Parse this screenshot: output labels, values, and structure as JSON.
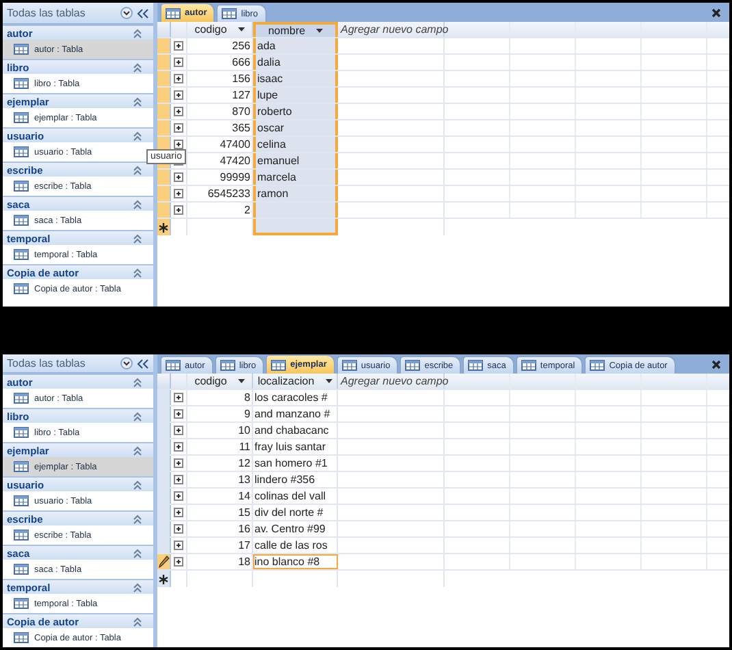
{
  "panels": [
    {
      "nav": {
        "title": "Todas las tablas",
        "groups": [
          {
            "name": "autor",
            "item": "autor : Tabla",
            "selected": true
          },
          {
            "name": "libro",
            "item": "libro : Tabla",
            "selected": false
          },
          {
            "name": "ejemplar",
            "item": "ejemplar : Tabla",
            "selected": false
          },
          {
            "name": "usuario",
            "item": "usuario : Tabla",
            "selected": false
          },
          {
            "name": "escribe",
            "item": "escribe : Tabla",
            "selected": false
          },
          {
            "name": "saca",
            "item": "saca : Tabla",
            "selected": false
          },
          {
            "name": "temporal",
            "item": "temporal : Tabla",
            "selected": false
          },
          {
            "name": "Copia de autor",
            "item": "Copia de autor : Tabla",
            "selected": false
          }
        ]
      },
      "tooltip": "usuario",
      "tabs": [
        {
          "label": "autor",
          "selected": true
        },
        {
          "label": "libro",
          "selected": false
        }
      ],
      "columns": [
        {
          "label": "codigo",
          "kind": "number",
          "selected": false
        },
        {
          "label": "nombre",
          "kind": "text",
          "selected": true
        },
        {
          "label": "Agregar nuevo campo",
          "kind": "add",
          "selected": false
        }
      ],
      "rows": [
        {
          "cells": [
            "256",
            "ada"
          ],
          "editing": false
        },
        {
          "cells": [
            "666",
            "dalia"
          ],
          "editing": false
        },
        {
          "cells": [
            "156",
            "isaac"
          ],
          "editing": false
        },
        {
          "cells": [
            "127",
            "lupe"
          ],
          "editing": false
        },
        {
          "cells": [
            "870",
            "roberto"
          ],
          "editing": false
        },
        {
          "cells": [
            "365",
            "oscar"
          ],
          "editing": false
        },
        {
          "cells": [
            "47400",
            "celina"
          ],
          "editing": false
        },
        {
          "cells": [
            "47420",
            "emanuel"
          ],
          "editing": false
        },
        {
          "cells": [
            "99999",
            "marcela"
          ],
          "editing": false
        },
        {
          "cells": [
            "6545233",
            "ramon"
          ],
          "editing": false
        },
        {
          "cells": [
            "2"
          ],
          "editing": false
        }
      ]
    },
    {
      "nav": {
        "title": "Todas las tablas",
        "groups": [
          {
            "name": "autor",
            "item": "autor : Tabla",
            "selected": false
          },
          {
            "name": "libro",
            "item": "libro : Tabla",
            "selected": false
          },
          {
            "name": "ejemplar",
            "item": "ejemplar : Tabla",
            "selected": true
          },
          {
            "name": "usuario",
            "item": "usuario : Tabla",
            "selected": false
          },
          {
            "name": "escribe",
            "item": "escribe : Tabla",
            "selected": false
          },
          {
            "name": "saca",
            "item": "saca : Tabla",
            "selected": false
          },
          {
            "name": "temporal",
            "item": "temporal : Tabla",
            "selected": false
          },
          {
            "name": "Copia de autor",
            "item": "Copia de autor : Tabla",
            "selected": false
          }
        ]
      },
      "tabs": [
        {
          "label": "autor",
          "selected": false
        },
        {
          "label": "libro",
          "selected": false
        },
        {
          "label": "ejemplar",
          "selected": true
        },
        {
          "label": "usuario",
          "selected": false
        },
        {
          "label": "escribe",
          "selected": false
        },
        {
          "label": "saca",
          "selected": false
        },
        {
          "label": "temporal",
          "selected": false
        },
        {
          "label": "Copia de autor",
          "selected": false
        }
      ],
      "columns": [
        {
          "label": "codigo",
          "kind": "number",
          "selected": false
        },
        {
          "label": "localizacion",
          "kind": "text",
          "selected": false
        },
        {
          "label": "Agregar nuevo campo",
          "kind": "add",
          "selected": false
        }
      ],
      "rows": [
        {
          "cells": [
            "8",
            "los caracoles #"
          ],
          "editing": false
        },
        {
          "cells": [
            "9",
            "and manzano #"
          ],
          "editing": false
        },
        {
          "cells": [
            "10",
            "and chabacanc"
          ],
          "editing": false
        },
        {
          "cells": [
            "11",
            "fray luis santar"
          ],
          "editing": false
        },
        {
          "cells": [
            "12",
            "san homero #1"
          ],
          "editing": false
        },
        {
          "cells": [
            "13",
            "lindero #356"
          ],
          "editing": false
        },
        {
          "cells": [
            "14",
            "colinas del vall"
          ],
          "editing": false
        },
        {
          "cells": [
            "15",
            "div del norte #"
          ],
          "editing": false
        },
        {
          "cells": [
            "16",
            "av. Centro #99"
          ],
          "editing": false
        },
        {
          "cells": [
            "17",
            "calle de las ros"
          ],
          "editing": false
        },
        {
          "cells": [
            "18",
            "ino blanco #8"
          ],
          "editing": true
        }
      ]
    }
  ]
}
